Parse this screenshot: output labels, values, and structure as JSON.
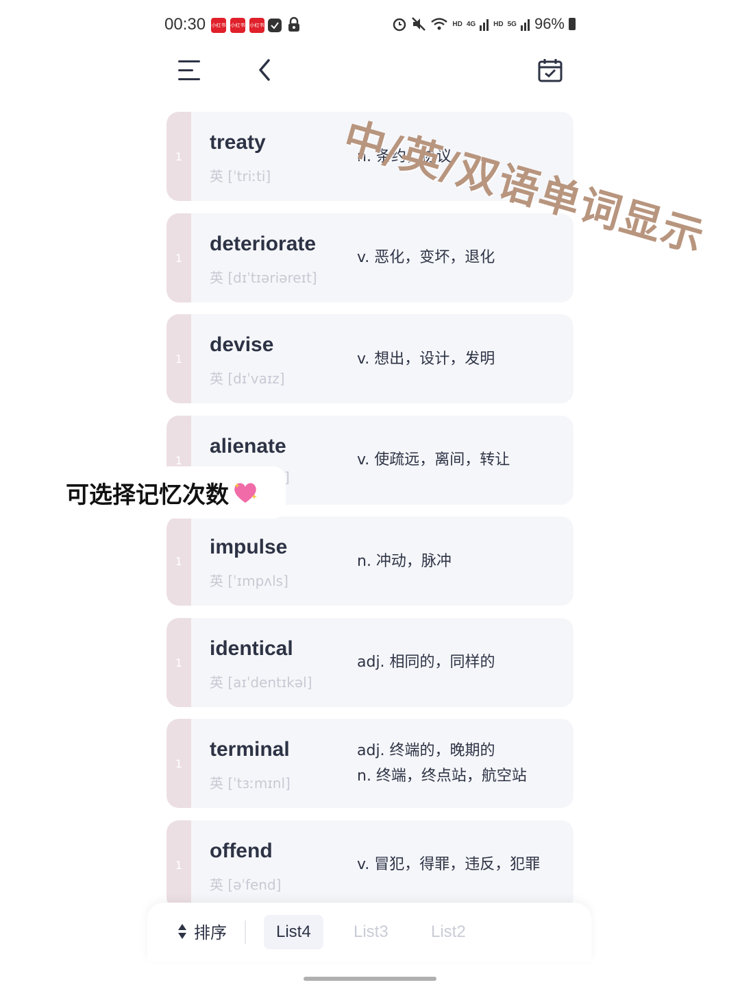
{
  "status_bar": {
    "time": "00:30",
    "notifications": [
      "小红书",
      "小红书",
      "小红书"
    ],
    "signal_labels": [
      "HD",
      "4G",
      "HD",
      "5G"
    ],
    "battery": "96%"
  },
  "header": {
    "menu_icon": "menu-icon",
    "back_icon": "chevron-left-icon",
    "calendar_icon": "calendar-icon"
  },
  "overlay": {
    "title": "中/英/双语单词显示",
    "caption": "可选择记忆次数"
  },
  "words": [
    {
      "count": "1",
      "word": "treaty",
      "phonetic": "英 [ˈtriːti]",
      "meanings": [
        "n. 条约，协议"
      ]
    },
    {
      "count": "1",
      "word": "deteriorate",
      "phonetic": "英 [dɪˈtɪəriəreɪt]",
      "meanings": [
        "v. 恶化，变坏，退化"
      ]
    },
    {
      "count": "1",
      "word": "devise",
      "phonetic": "英 [dɪˈvaɪz]",
      "meanings": [
        "v. 想出，设计，发明"
      ]
    },
    {
      "count": "1",
      "word": "alienate",
      "phonetic": "]",
      "meanings": [
        "v. 使疏远，离间，转让"
      ]
    },
    {
      "count": "1",
      "word": "impulse",
      "phonetic": "英 [ˈɪmpʌls]",
      "meanings": [
        "n. 冲动，脉冲"
      ]
    },
    {
      "count": "1",
      "word": "identical",
      "phonetic": "英 [aɪˈdentɪkəl]",
      "meanings": [
        "adj. 相同的，同样的"
      ]
    },
    {
      "count": "1",
      "word": "terminal",
      "phonetic": "英 [ˈtɜːmɪnl]",
      "meanings": [
        "adj. 终端的，晚期的",
        "n. 终端，终点站，航空站"
      ]
    },
    {
      "count": "1",
      "word": "offend",
      "phonetic": "英 [əˈfend]",
      "meanings": [
        "v. 冒犯，得罪，违反，犯罪"
      ]
    }
  ],
  "bottom_bar": {
    "sort_label": "排序",
    "tabs": [
      {
        "label": "List4",
        "active": true
      },
      {
        "label": "List3",
        "active": false
      },
      {
        "label": "List2",
        "active": false
      }
    ]
  },
  "colors": {
    "text": "#2d3345",
    "card_bg": "#f5f6f9",
    "stripe": "#ecdfe3",
    "phonetic": "#c7cad4",
    "overlay_title": "#b8957e",
    "inactive_tab": "#c9ccd6"
  }
}
